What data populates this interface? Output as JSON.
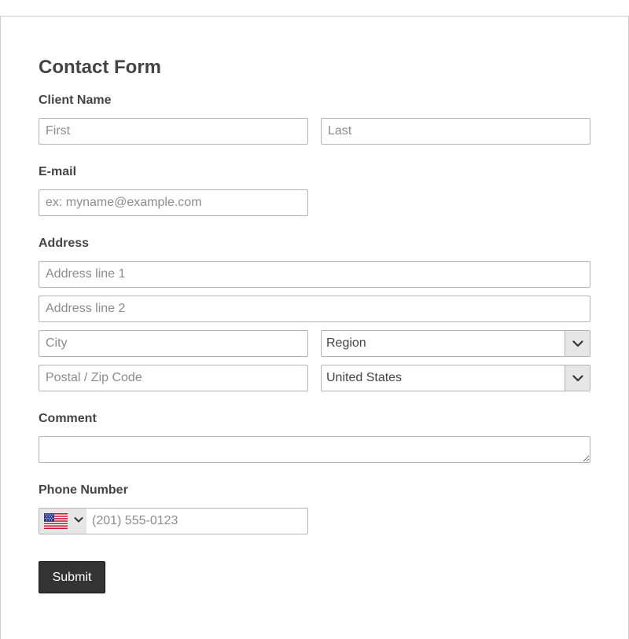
{
  "form": {
    "title": "Contact Form",
    "client_name": {
      "label": "Client Name",
      "first_placeholder": "First",
      "last_placeholder": "Last"
    },
    "email": {
      "label": "E-mail",
      "placeholder": "ex: myname@example.com"
    },
    "address": {
      "label": "Address",
      "line1_placeholder": "Address line 1",
      "line2_placeholder": "Address line 2",
      "city_placeholder": "City",
      "region_value": "Region",
      "postal_placeholder": "Postal / Zip Code",
      "country_value": "United States"
    },
    "comment": {
      "label": "Comment",
      "placeholder": ""
    },
    "phone": {
      "label": "Phone Number",
      "country_flag": "us-flag-icon",
      "placeholder": "(201) 555-0123"
    },
    "submit_label": "Submit"
  },
  "colors": {
    "text": "#444444",
    "placeholder": "#8c8c8c",
    "border": "#b3b3b3",
    "select_arrow_bg": "#e6e6e6",
    "button_bg": "#333333",
    "button_text": "#ffffff"
  }
}
